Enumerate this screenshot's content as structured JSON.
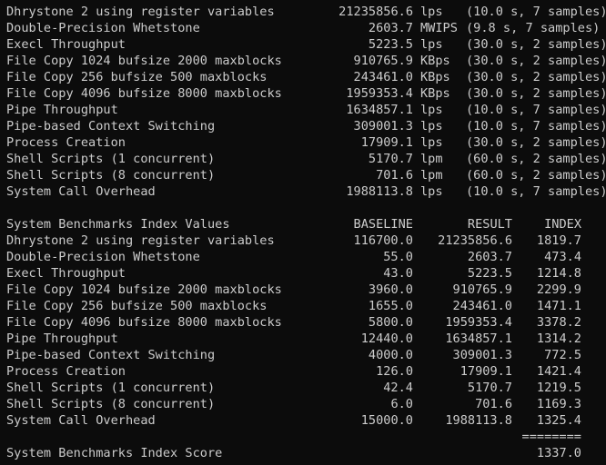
{
  "results": [
    {
      "name": "Dhrystone 2 using register variables",
      "value": "21235856.6",
      "unit": "lps",
      "note": "(10.0 s, 7 samples)"
    },
    {
      "name": "Double-Precision Whetstone",
      "value": "2603.7",
      "unit": "MWIPS",
      "note": "(9.8 s, 7 samples)"
    },
    {
      "name": "Execl Throughput",
      "value": "5223.5",
      "unit": "lps",
      "note": "(30.0 s, 2 samples)"
    },
    {
      "name": "File Copy 1024 bufsize 2000 maxblocks",
      "value": "910765.9",
      "unit": "KBps",
      "note": "(30.0 s, 2 samples)"
    },
    {
      "name": "File Copy 256 bufsize 500 maxblocks",
      "value": "243461.0",
      "unit": "KBps",
      "note": "(30.0 s, 2 samples)"
    },
    {
      "name": "File Copy 4096 bufsize 8000 maxblocks",
      "value": "1959353.4",
      "unit": "KBps",
      "note": "(30.0 s, 2 samples)"
    },
    {
      "name": "Pipe Throughput",
      "value": "1634857.1",
      "unit": "lps",
      "note": "(10.0 s, 7 samples)"
    },
    {
      "name": "Pipe-based Context Switching",
      "value": "309001.3",
      "unit": "lps",
      "note": "(10.0 s, 7 samples)"
    },
    {
      "name": "Process Creation",
      "value": "17909.1",
      "unit": "lps",
      "note": "(30.0 s, 2 samples)"
    },
    {
      "name": "Shell Scripts (1 concurrent)",
      "value": "5170.7",
      "unit": "lpm",
      "note": "(60.0 s, 2 samples)"
    },
    {
      "name": "Shell Scripts (8 concurrent)",
      "value": "701.6",
      "unit": "lpm",
      "note": "(60.0 s, 2 samples)"
    },
    {
      "name": "System Call Overhead",
      "value": "1988113.8",
      "unit": "lps",
      "note": "(10.0 s, 7 samples)"
    }
  ],
  "index": {
    "header": {
      "title": "System Benchmarks Index Values",
      "baseline": "BASELINE",
      "result": "RESULT",
      "index": "INDEX"
    },
    "rows": [
      {
        "name": "Dhrystone 2 using register variables",
        "baseline": "116700.0",
        "result": "21235856.6",
        "index": "1819.7"
      },
      {
        "name": "Double-Precision Whetstone",
        "baseline": "55.0",
        "result": "2603.7",
        "index": "473.4"
      },
      {
        "name": "Execl Throughput",
        "baseline": "43.0",
        "result": "5223.5",
        "index": "1214.8"
      },
      {
        "name": "File Copy 1024 bufsize 2000 maxblocks",
        "baseline": "3960.0",
        "result": "910765.9",
        "index": "2299.9"
      },
      {
        "name": "File Copy 256 bufsize 500 maxblocks",
        "baseline": "1655.0",
        "result": "243461.0",
        "index": "1471.1"
      },
      {
        "name": "File Copy 4096 bufsize 8000 maxblocks",
        "baseline": "5800.0",
        "result": "1959353.4",
        "index": "3378.2"
      },
      {
        "name": "Pipe Throughput",
        "baseline": "12440.0",
        "result": "1634857.1",
        "index": "1314.2"
      },
      {
        "name": "Pipe-based Context Switching",
        "baseline": "4000.0",
        "result": "309001.3",
        "index": "772.5"
      },
      {
        "name": "Process Creation",
        "baseline": "126.0",
        "result": "17909.1",
        "index": "1421.4"
      },
      {
        "name": "Shell Scripts (1 concurrent)",
        "baseline": "42.4",
        "result": "5170.7",
        "index": "1219.5"
      },
      {
        "name": "Shell Scripts (8 concurrent)",
        "baseline": "6.0",
        "result": "701.6",
        "index": "1169.3"
      },
      {
        "name": "System Call Overhead",
        "baseline": "15000.0",
        "result": "1988113.8",
        "index": "1325.4"
      }
    ],
    "separator": "========",
    "score_label": "System Benchmarks Index Score",
    "score": "1337.0"
  }
}
